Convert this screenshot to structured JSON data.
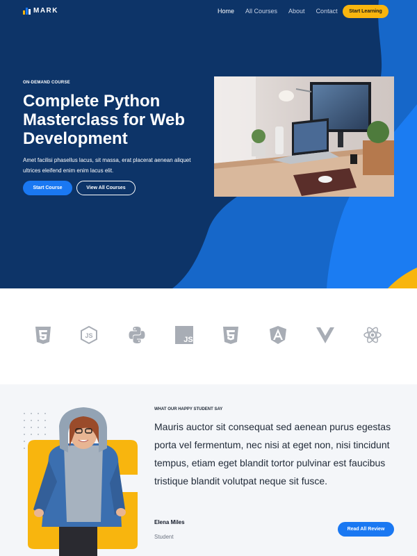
{
  "brand": {
    "name": "MARK"
  },
  "nav": {
    "links": [
      {
        "label": "Home"
      },
      {
        "label": "All Courses"
      },
      {
        "label": "About"
      },
      {
        "label": "Contact"
      }
    ],
    "cta": "Start Learning"
  },
  "hero": {
    "eyebrow": "ON-DEMAND COURSE",
    "title": "Complete Python Masterclass for Web Development",
    "text": "Amet facilisi phasellus lacus, sit massa, erat placerat aenean aliquet ultrices eleifend enim enim lacus elit.",
    "primary_button": "Start Course",
    "secondary_button": "View All Courses"
  },
  "tech_logos": [
    {
      "icon": "html5-icon"
    },
    {
      "icon": "nodejs-icon"
    },
    {
      "icon": "python-icon"
    },
    {
      "icon": "javascript-icon",
      "text": "JS"
    },
    {
      "icon": "css3-icon"
    },
    {
      "icon": "angular-icon"
    },
    {
      "icon": "vue-icon"
    },
    {
      "icon": "react-icon"
    }
  ],
  "testimonial": {
    "eyebrow": "WHAT OUR HAPPY STUDENT SAY",
    "quote": "Mauris auctor sit consequat sed aenean purus egestas porta vel fermentum, nec nisi at eget non, nisi tincidunt tempus, etiam eget blandit tortor pulvinar est faucibus tristique blandit volutpat neque sit fusce.",
    "name": "Elena Miles",
    "role": "Student",
    "button": "Read All Review"
  },
  "colors": {
    "navy": "#0d3468",
    "blue": "#1a78f2",
    "yellow": "#f8b50e",
    "light_bg": "#f4f6f9",
    "icon_gray": "#a8adb5"
  }
}
